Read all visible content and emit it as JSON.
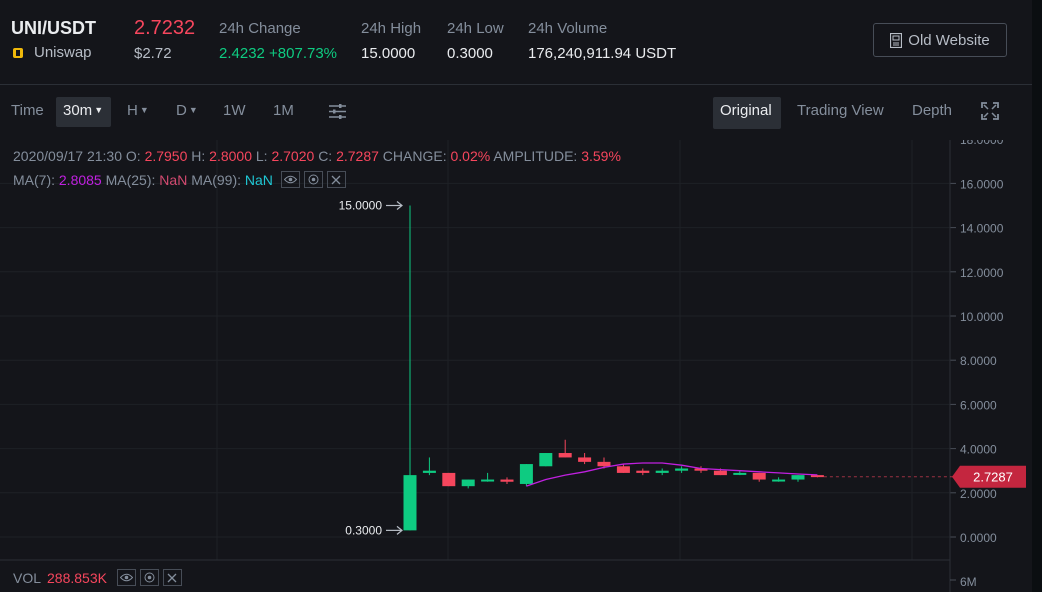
{
  "header": {
    "pair": "UNI/USDT",
    "coin_name": "Uniswap",
    "last_price": "2.7232",
    "last_price_usd": "$2.72",
    "stats": [
      {
        "label": "24h Change",
        "value": "2.4232 +807.73%"
      },
      {
        "label": "24h High",
        "value": "15.0000"
      },
      {
        "label": "24h Low",
        "value": "0.3000"
      },
      {
        "label": "24h Volume",
        "value": "176,240,911.94 USDT"
      }
    ],
    "old_website_label": "Old Website"
  },
  "toolbar": {
    "time_label": "Time",
    "interval_selected": "30m",
    "hour_label": "H",
    "day_label": "D",
    "week_label": "1W",
    "month_label": "1M",
    "view_original": "Original",
    "view_trading": "Trading View",
    "view_depth": "Depth"
  },
  "legend": {
    "datetime": "2020/09/17 21:30",
    "o_label": "O:",
    "o_value": "2.7950",
    "h_label": "H:",
    "h_value": "2.8000",
    "l_label": "L:",
    "l_value": "2.7020",
    "c_label": "C:",
    "c_value": "2.7287",
    "change_label": "CHANGE:",
    "change_value": "0.02%",
    "amp_label": "AMPLITUDE:",
    "amp_value": "3.59%",
    "ma7_label": "MA(7):",
    "ma7_value": "2.8085",
    "ma25_label": "MA(25):",
    "ma25_value": "NaN",
    "ma99_label": "MA(99):",
    "ma99_value": "NaN"
  },
  "volume": {
    "label": "VOL",
    "value": "288.853K"
  },
  "chart_data": {
    "type": "candlestick",
    "y_ticks": [
      "16.0000",
      "14.0000",
      "12.0000",
      "10.0000",
      "8.0000",
      "6.0000",
      "4.0000",
      "2.0000",
      "0.0000"
    ],
    "ylim": [
      0,
      18
    ],
    "vol_tick": "6M",
    "high_marker": "15.0000",
    "low_marker": "0.3000",
    "current_price_tag": "2.7287",
    "candles": [
      {
        "o": 0.3,
        "h": 15.0,
        "l": 0.3,
        "c": 2.8
      },
      {
        "o": 2.9,
        "h": 3.6,
        "l": 2.8,
        "c": 3.0
      },
      {
        "o": 2.9,
        "h": 2.9,
        "l": 2.3,
        "c": 2.3
      },
      {
        "o": 2.3,
        "h": 2.6,
        "l": 2.2,
        "c": 2.6
      },
      {
        "o": 2.6,
        "h": 2.9,
        "l": 2.5,
        "c": 2.6
      },
      {
        "o": 2.6,
        "h": 2.7,
        "l": 2.4,
        "c": 2.5
      },
      {
        "o": 2.4,
        "h": 3.3,
        "l": 2.3,
        "c": 3.3
      },
      {
        "o": 3.2,
        "h": 3.8,
        "l": 3.2,
        "c": 3.8
      },
      {
        "o": 3.8,
        "h": 4.4,
        "l": 3.6,
        "c": 3.6
      },
      {
        "o": 3.6,
        "h": 3.8,
        "l": 3.3,
        "c": 3.4
      },
      {
        "o": 3.4,
        "h": 3.6,
        "l": 3.1,
        "c": 3.2
      },
      {
        "o": 3.2,
        "h": 3.3,
        "l": 2.9,
        "c": 2.9
      },
      {
        "o": 3.0,
        "h": 3.1,
        "l": 2.8,
        "c": 2.9
      },
      {
        "o": 2.9,
        "h": 3.1,
        "l": 2.8,
        "c": 3.0
      },
      {
        "o": 3.0,
        "h": 3.2,
        "l": 2.9,
        "c": 3.1
      },
      {
        "o": 3.1,
        "h": 3.2,
        "l": 2.9,
        "c": 3.0
      },
      {
        "o": 3.0,
        "h": 3.1,
        "l": 2.8,
        "c": 2.8
      },
      {
        "o": 2.9,
        "h": 3.0,
        "l": 2.8,
        "c": 2.9
      },
      {
        "o": 2.9,
        "h": 2.9,
        "l": 2.5,
        "c": 2.6
      },
      {
        "o": 2.6,
        "h": 2.7,
        "l": 2.5,
        "c": 2.6
      },
      {
        "o": 2.6,
        "h": 2.8,
        "l": 2.5,
        "c": 2.8
      },
      {
        "o": 2.8,
        "h": 2.8,
        "l": 2.7,
        "c": 2.73
      }
    ],
    "ma7": [
      null,
      null,
      null,
      null,
      null,
      null,
      2.3,
      2.6,
      2.8,
      2.95,
      3.15,
      3.3,
      3.35,
      3.35,
      3.25,
      3.1,
      3.05,
      3.0,
      2.95,
      2.9,
      2.85,
      2.81
    ],
    "colors": {
      "up": "#0ecb81",
      "down": "#f6465d",
      "ma7": "#c020e0",
      "grid": "#1e2126",
      "axis_text": "#848e9c"
    }
  }
}
